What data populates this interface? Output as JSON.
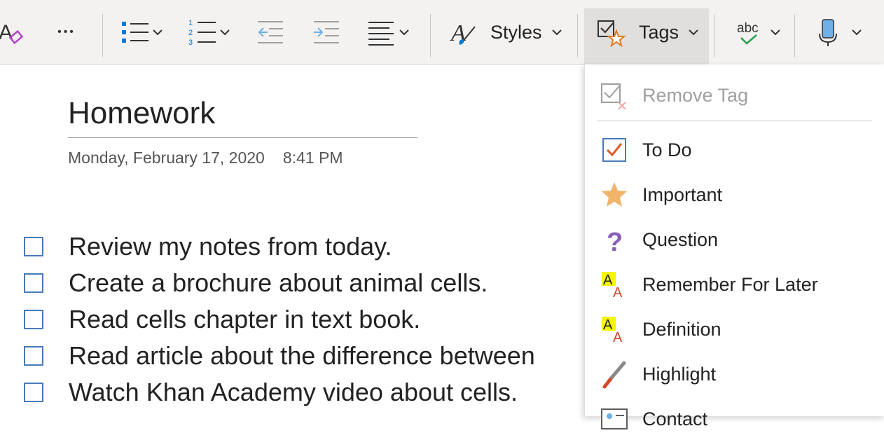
{
  "toolbar": {
    "styles_label": "Styles",
    "tags_label": "Tags",
    "more_glyph": "•••",
    "spell_glyph": "abc"
  },
  "page": {
    "title": "Homework",
    "date": "Monday, February 17, 2020",
    "time": "8:41 PM"
  },
  "todos": [
    "Review my notes from today.",
    "Create a brochure about animal cells.",
    "Read cells chapter in text book.",
    "Read article about the difference between",
    "Watch Khan Academy video about cells."
  ],
  "tags_menu": {
    "remove_tag": "Remove Tag",
    "items": [
      {
        "label": "To Do",
        "icon": "todo-checkbox-icon"
      },
      {
        "label": "Important",
        "icon": "star-icon"
      },
      {
        "label": "Question",
        "icon": "question-icon"
      },
      {
        "label": "Remember For Later",
        "icon": "highlight-a-icon"
      },
      {
        "label": "Definition",
        "icon": "highlight-a-icon"
      },
      {
        "label": "Highlight",
        "icon": "highlighter-pen-icon"
      },
      {
        "label": "Contact",
        "icon": "contact-card-icon"
      }
    ]
  },
  "colors": {
    "accent_blue": "#0078d4",
    "checkbox_border": "#4a7ab5",
    "todo_check": "#e05a2b",
    "star": "#f2b46b",
    "question": "#8a5fb8",
    "highlight_yellow": "#f5f500",
    "highlight_a_red": "#d24726",
    "pen_red": "#d24726"
  }
}
